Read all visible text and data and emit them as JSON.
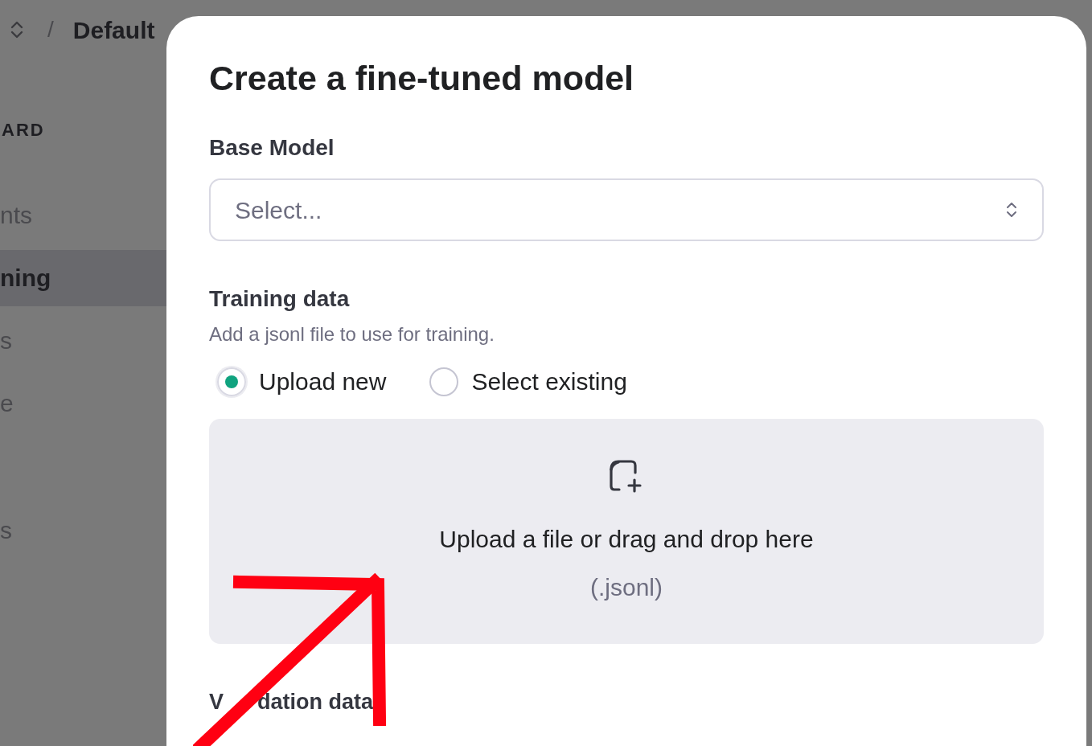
{
  "header": {
    "separator": "/",
    "project": "Default"
  },
  "sidebar": {
    "section_label": "ARD",
    "items": [
      {
        "label": "nts",
        "selected": false
      },
      {
        "label": "ning",
        "selected": true
      },
      {
        "label": "s",
        "selected": false
      },
      {
        "label": "e",
        "selected": false
      },
      {
        "label": "s",
        "selected": false
      }
    ]
  },
  "modal": {
    "title": "Create a fine-tuned model",
    "base_model": {
      "label": "Base Model",
      "placeholder": "Select..."
    },
    "training_data": {
      "label": "Training data",
      "hint": "Add a jsonl file to use for training.",
      "options": [
        {
          "label": "Upload new",
          "selected": true
        },
        {
          "label": "Select existing",
          "selected": false
        }
      ],
      "dropzone": {
        "text": "Upload a file or drag and drop here",
        "formats": "(.jsonl)"
      }
    },
    "validation_data": {
      "label_visible_parts": [
        "V",
        "dation data"
      ]
    }
  }
}
